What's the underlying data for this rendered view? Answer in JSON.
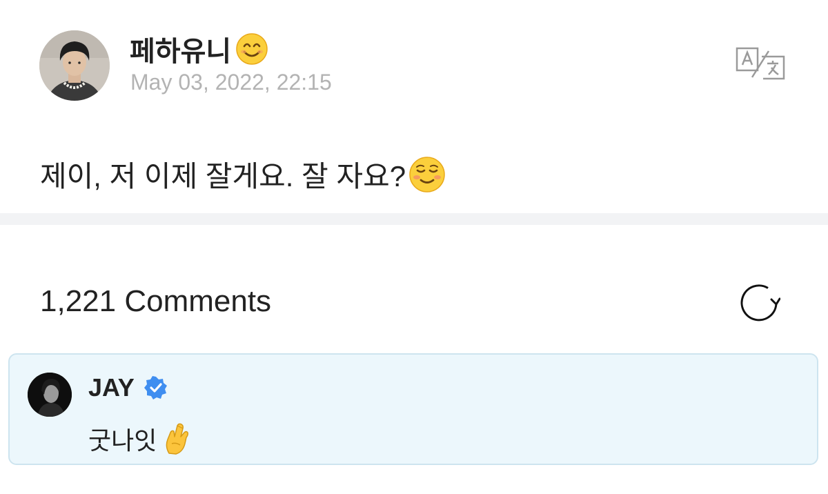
{
  "post": {
    "author": {
      "name": "페하유니",
      "name_emoji": "smiling-face-with-smiling-eyes",
      "avatar": "user-avatar"
    },
    "timestamp": "May 03, 2022, 22:15",
    "translate_icon": "translate-icon",
    "body_text": "제이, 저 이제 잘게요. 잘 자요?",
    "body_emoji": "smiling-face"
  },
  "comments": {
    "count_label": "1,221 Comments",
    "refresh_icon": "refresh-icon",
    "highlighted": {
      "author": "JAY",
      "verified": true,
      "text": "굿나잇",
      "text_emoji": "crossed-fingers",
      "background_color": "#ecf7fc",
      "border_color": "#cde4ef"
    }
  },
  "colors": {
    "text": "#222222",
    "muted": "#b3b3b3",
    "divider": "#f2f3f5",
    "verified_blue": "#3f8ef0"
  }
}
